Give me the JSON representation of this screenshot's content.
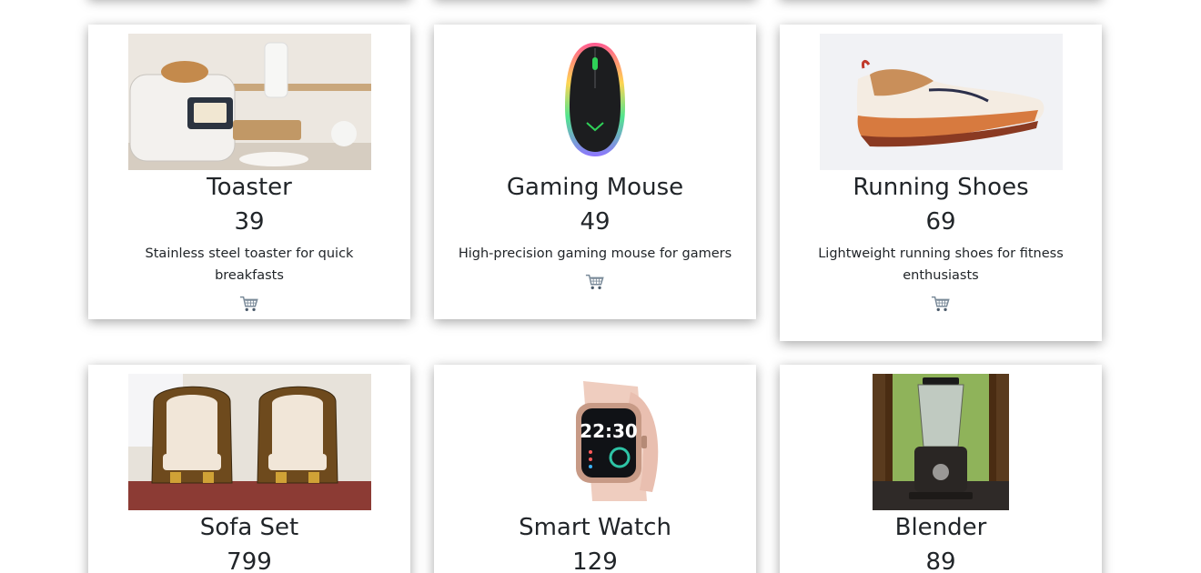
{
  "products": [
    {
      "name": "Toaster",
      "price": "39",
      "description": "Stainless steel toaster for quick breakfasts",
      "image_icon": "toaster-photo"
    },
    {
      "name": "Gaming Mouse",
      "price": "49",
      "description": "High-precision gaming mouse for gamers",
      "image_icon": "gaming-mouse-photo"
    },
    {
      "name": "Running Shoes",
      "price": "69",
      "description": "Lightweight running shoes for fitness enthusiasts",
      "image_icon": "running-shoes-photo"
    },
    {
      "name": "Sofa Set",
      "price": "799",
      "description": "",
      "image_icon": "sofa-set-photo"
    },
    {
      "name": "Smart Watch",
      "price": "129",
      "description": "",
      "image_icon": "smart-watch-photo"
    },
    {
      "name": "Blender",
      "price": "89",
      "description": "",
      "image_icon": "blender-photo"
    }
  ],
  "cart_icon": "shopping-cart-icon"
}
